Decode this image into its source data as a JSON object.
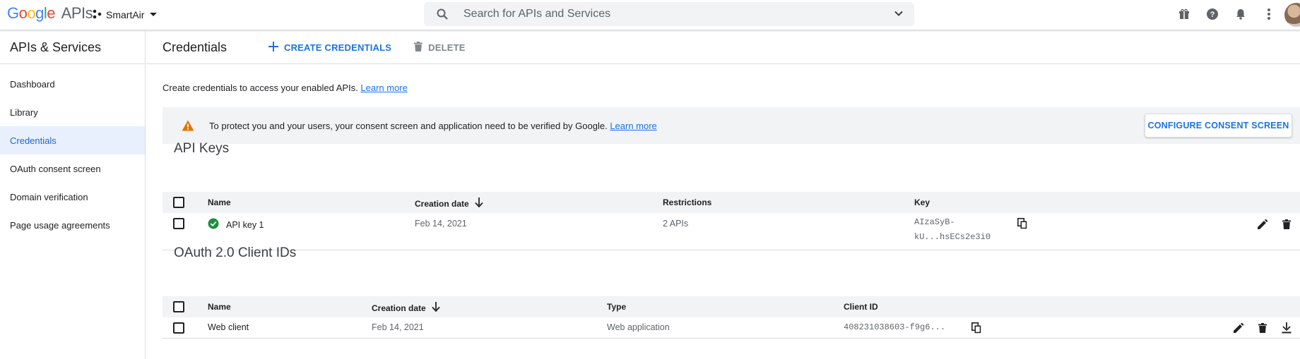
{
  "header": {
    "logo_google": "Google",
    "logo_apis": "APIs",
    "project_name": "SmartAir",
    "search_placeholder": "Search for APIs and Services"
  },
  "sidebar": {
    "title": "APIs & Services",
    "items": [
      {
        "label": "Dashboard",
        "active": false
      },
      {
        "label": "Library",
        "active": false
      },
      {
        "label": "Credentials",
        "active": true
      },
      {
        "label": "OAuth consent screen",
        "active": false
      },
      {
        "label": "Domain verification",
        "active": false
      },
      {
        "label": "Page usage agreements",
        "active": false
      }
    ]
  },
  "main": {
    "title": "Credentials",
    "create_label": "CREATE CREDENTIALS",
    "delete_label": "DELETE",
    "intro_text": "Create credentials to access your enabled APIs.",
    "intro_link": "Learn more",
    "banner": {
      "message": "To protect you and your users, your consent screen and application need to be verified by Google.",
      "link": "Learn more",
      "button": "CONFIGURE CONSENT SCREEN"
    },
    "api_keys": {
      "title": "API Keys",
      "columns": [
        "Name",
        "Creation date",
        "Restrictions",
        "Key"
      ],
      "rows": [
        {
          "name": "API key 1",
          "date": "Feb 14, 2021",
          "restrictions": "2 APIs",
          "key_line1": "AIzaSyB-",
          "key_line2": "kU...hsECs2e3i0"
        }
      ]
    },
    "oauth": {
      "title": "OAuth 2.0 Client IDs",
      "columns": [
        "Name",
        "Creation date",
        "Type",
        "Client ID"
      ],
      "rows": [
        {
          "name": "Web client",
          "date": "Feb 14, 2021",
          "type": "Web application",
          "client_id": "408231038603-f9g6..."
        }
      ]
    }
  },
  "colors": {
    "accent": "#1a73e8",
    "active_bg": "#e8f0fe",
    "warning": "#e37400",
    "success": "#1e8e3e"
  }
}
